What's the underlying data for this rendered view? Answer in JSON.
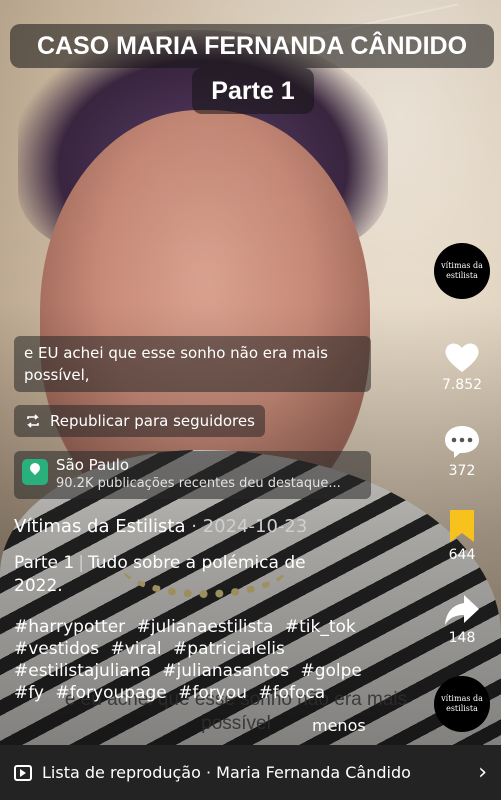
{
  "video": {
    "title_line1": "CASO MARIA FERNANDA CÂNDIDO",
    "title_line2": "Parte 1",
    "burned_caption": "e eu achei que esse sonho não era mais possível"
  },
  "overlay": {
    "caption": "e EU achei que esse sonho não era mais possível,",
    "republish_label": "Republicar para seguidores",
    "location_name": "São Paulo",
    "location_sub": "90.2K publicações recentes deu destaque..."
  },
  "post": {
    "author": "Vítimas da Estilista",
    "separator": "·",
    "date": "2024-10-23",
    "desc_part": "Parte 1",
    "desc_sep": "|",
    "desc_text": "Tudo sobre a polémica de 2022.",
    "hashtags": [
      "#harrypotter",
      "#julianaestilista",
      "#tik_tok",
      "#vestidos",
      "#viral",
      "#patricialelis",
      "#estilistajuliana",
      "#julianasantos",
      "#golpe",
      "#fy",
      "#foryoupage",
      "#foryou",
      "#fofoca"
    ],
    "more_label": "menos"
  },
  "sidebar": {
    "avatar_text": "vítimas da estilista",
    "likes": "7.852",
    "comments": "372",
    "saves": "644",
    "shares": "148",
    "sound_text": "vítimas da estilista"
  },
  "bottom": {
    "playlist_label": "Lista de reprodução · Maria Fernanda Cândido"
  },
  "colors": {
    "save_accent": "#f7c21d",
    "location_pin": "#29b07c"
  }
}
